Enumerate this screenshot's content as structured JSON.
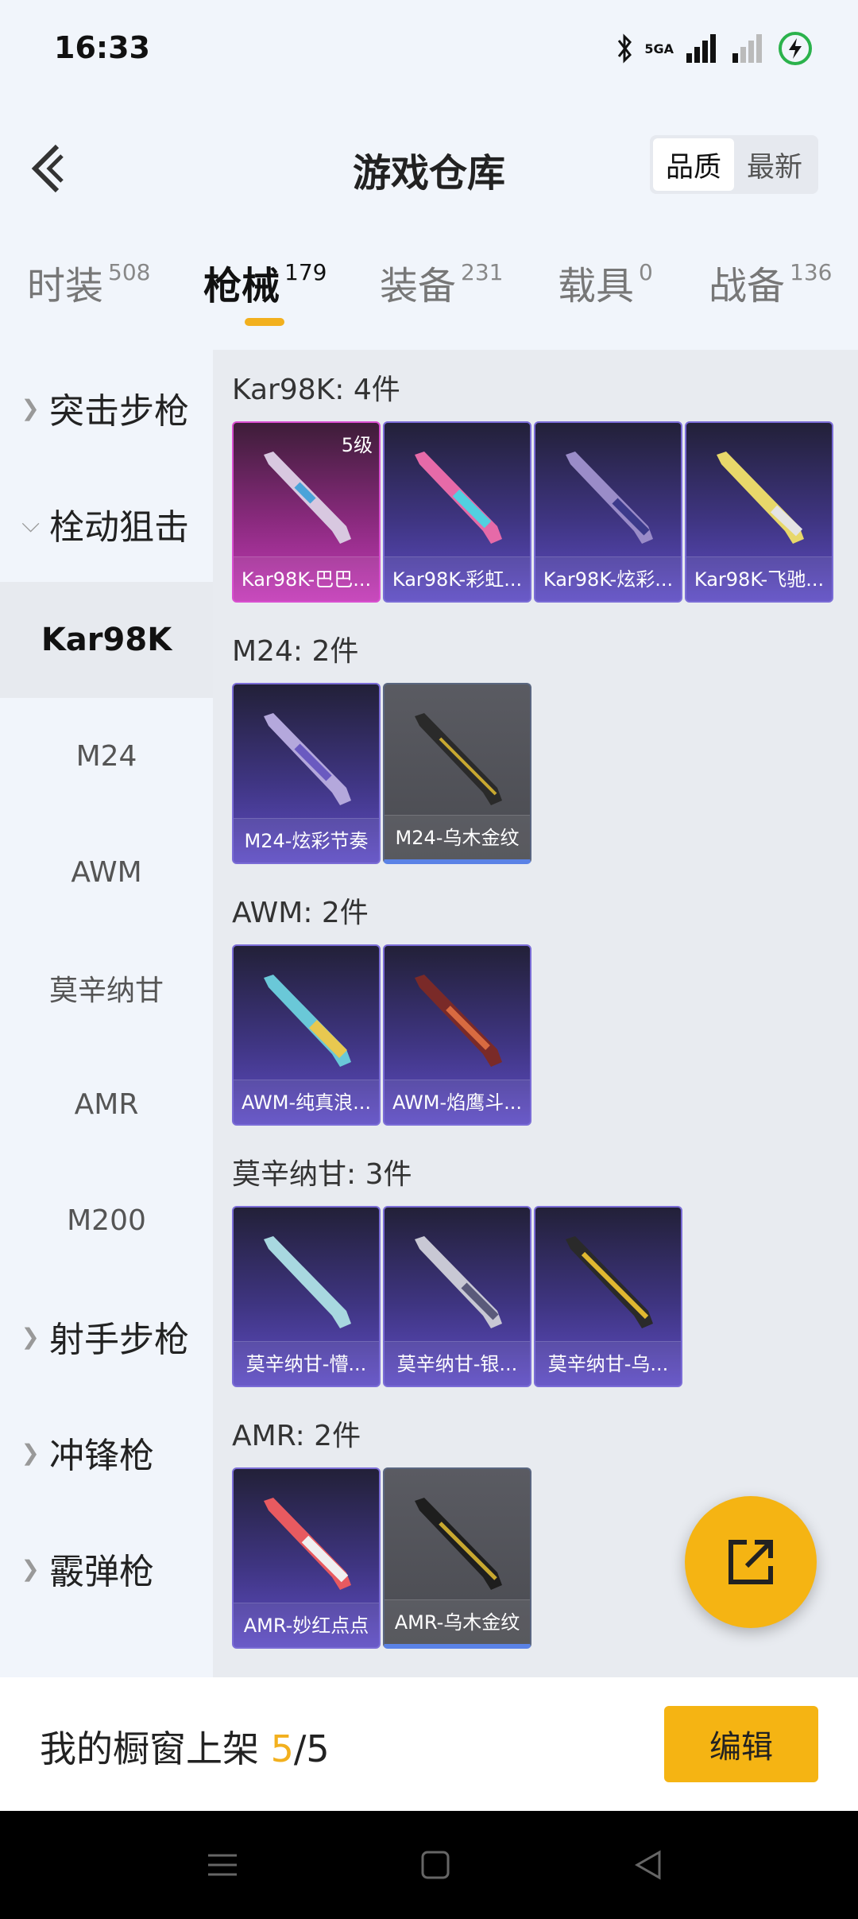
{
  "status": {
    "time": "16:33",
    "network": "5GA"
  },
  "header": {
    "title": "游戏仓库",
    "sort_quality": "品质",
    "sort_latest": "最新"
  },
  "tabs": [
    {
      "label": "时装",
      "count": "508"
    },
    {
      "label": "枪械",
      "count": "179"
    },
    {
      "label": "装备",
      "count": "231"
    },
    {
      "label": "载具",
      "count": "0"
    },
    {
      "label": "战备",
      "count": "136"
    }
  ],
  "sidebar": {
    "assault": "突击步枪",
    "bolt": "栓动狙击",
    "sub": [
      "Kar98K",
      "M24",
      "AWM",
      "莫辛纳甘",
      "AMR",
      "M200"
    ],
    "marksman": "射手步枪",
    "smg": "冲锋枪",
    "shotgun": "霰弹枪"
  },
  "sections": [
    {
      "title": "Kar98K: 4件",
      "items": [
        {
          "name": "Kar98K-巴巴...",
          "level": "5级",
          "tier": "pink"
        },
        {
          "name": "Kar98K-彩虹...",
          "tier": "purple"
        },
        {
          "name": "Kar98K-炫彩...",
          "tier": "purple"
        },
        {
          "name": "Kar98K-飞驰...",
          "tier": "purple"
        }
      ]
    },
    {
      "title": "M24: 2件",
      "items": [
        {
          "name": "M24-炫彩节奏",
          "tier": "purple"
        },
        {
          "name": "M24-乌木金纹",
          "tier": "gray"
        }
      ]
    },
    {
      "title": "AWM: 2件",
      "items": [
        {
          "name": "AWM-纯真浪...",
          "tier": "purple"
        },
        {
          "name": "AWM-焰鹰斗...",
          "tier": "purple"
        }
      ]
    },
    {
      "title": "莫辛纳甘: 3件",
      "items": [
        {
          "name": "莫辛纳甘-懵...",
          "tier": "purple"
        },
        {
          "name": "莫辛纳甘-银...",
          "tier": "purple"
        },
        {
          "name": "莫辛纳甘-乌...",
          "tier": "purple"
        }
      ]
    },
    {
      "title": "AMR: 2件",
      "items": [
        {
          "name": "AMR-妙红点点",
          "tier": "purple"
        },
        {
          "name": "AMR-乌木金纹",
          "tier": "gray"
        }
      ]
    }
  ],
  "bottom": {
    "label": "我的橱窗上架 ",
    "current": "5",
    "total": "/5",
    "edit": "编辑"
  },
  "colors": {
    "accent": "#f5b413",
    "card_purple": "#5e4cc4",
    "card_pink": "#c43bb8",
    "card_gray": "#4a4b51"
  }
}
